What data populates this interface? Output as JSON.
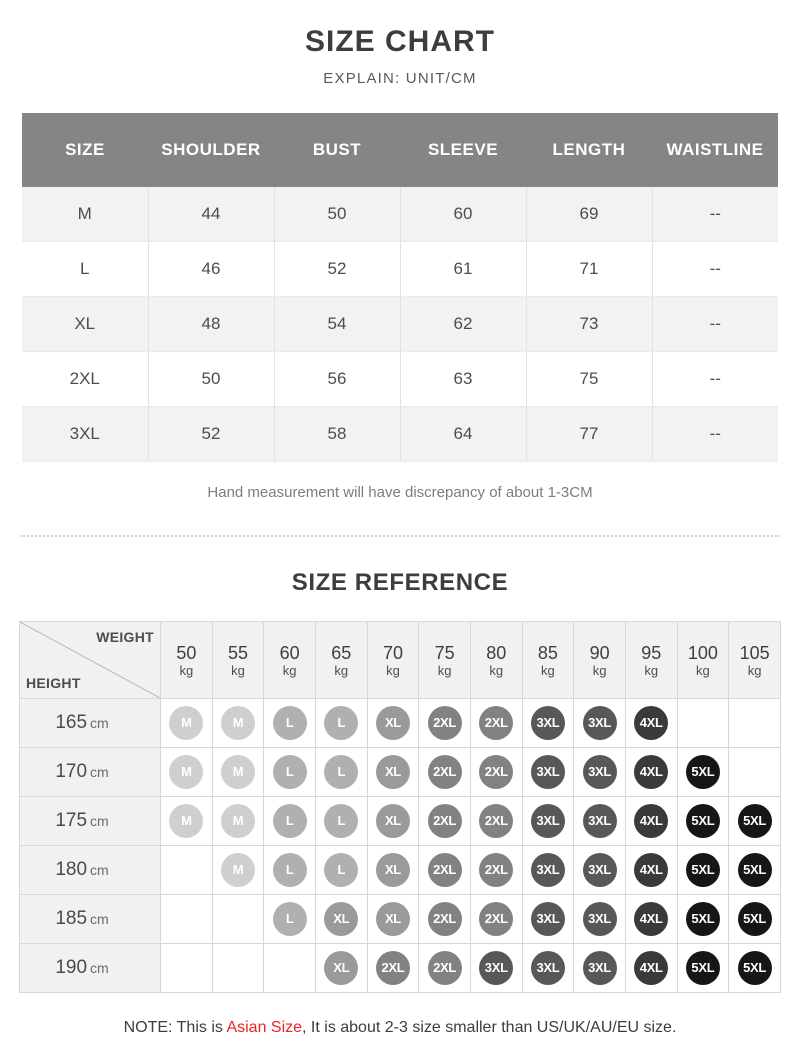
{
  "size_chart": {
    "title": "SIZE CHART",
    "subtitle": "EXPLAIN:  UNIT/CM",
    "columns": [
      "SIZE",
      "SHOULDER",
      "BUST",
      "SLEEVE",
      "LENGTH",
      "WAISTLINE"
    ],
    "rows": [
      [
        "M",
        "44",
        "50",
        "60",
        "69",
        "--"
      ],
      [
        "L",
        "46",
        "52",
        "61",
        "71",
        "--"
      ],
      [
        "XL",
        "48",
        "54",
        "62",
        "73",
        "--"
      ],
      [
        "2XL",
        "50",
        "56",
        "63",
        "75",
        "--"
      ],
      [
        "3XL",
        "52",
        "58",
        "64",
        "77",
        "--"
      ]
    ],
    "footnote": "Hand measurement will have discrepancy of about 1-3CM",
    "header_bg": "#858585",
    "row_alt_bg": "#f2f2f2"
  },
  "size_reference": {
    "title": "SIZE REFERENCE",
    "corner": {
      "weight_label": "WEIGHT",
      "height_label": "HEIGHT"
    },
    "weight_unit": "kg",
    "height_unit": "cm",
    "weights": [
      "50",
      "55",
      "60",
      "65",
      "70",
      "75",
      "80",
      "85",
      "90",
      "95",
      "100",
      "105"
    ],
    "heights": [
      "165",
      "170",
      "175",
      "180",
      "185",
      "190"
    ],
    "grid": [
      [
        "M",
        "M",
        "L",
        "L",
        "XL",
        "2XL",
        "2XL",
        "3XL",
        "3XL",
        "4XL",
        "",
        ""
      ],
      [
        "M",
        "M",
        "L",
        "L",
        "XL",
        "2XL",
        "2XL",
        "3XL",
        "3XL",
        "4XL",
        "5XL",
        ""
      ],
      [
        "M",
        "M",
        "L",
        "L",
        "XL",
        "2XL",
        "2XL",
        "3XL",
        "3XL",
        "4XL",
        "5XL",
        "5XL"
      ],
      [
        "",
        "M",
        "L",
        "L",
        "XL",
        "2XL",
        "2XL",
        "3XL",
        "3XL",
        "4XL",
        "5XL",
        "5XL"
      ],
      [
        "",
        "",
        "L",
        "XL",
        "XL",
        "2XL",
        "2XL",
        "3XL",
        "3XL",
        "4XL",
        "5XL",
        "5XL"
      ],
      [
        "",
        "",
        "",
        "XL",
        "2XL",
        "2XL",
        "3XL",
        "3XL",
        "3XL",
        "4XL",
        "5XL",
        "5XL"
      ]
    ],
    "bubble_colors": {
      "M": "#cfcfcf",
      "L": "#b0b0b0",
      "XL": "#9a9a9a",
      "2XL": "#828282",
      "3XL": "#585858",
      "4XL": "#3a3a3a",
      "5XL": "#161616"
    }
  },
  "bottom_note": {
    "prefix": "NOTE: This is ",
    "accent": "Asian Size",
    "suffix": ", It is about 2-3 size smaller than US/UK/AU/EU size.",
    "accent_color": "#ee2222"
  }
}
